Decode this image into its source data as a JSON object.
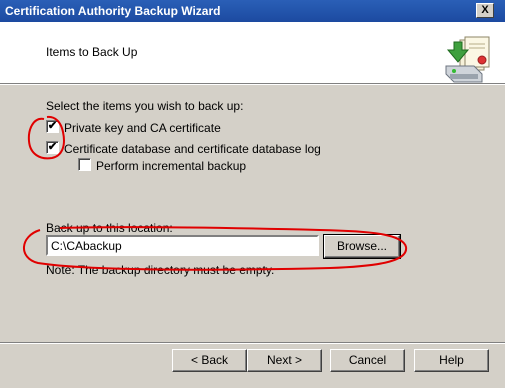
{
  "window": {
    "title": "Certification Authority Backup Wizard",
    "close_label": "X"
  },
  "header": {
    "heading": "Items to Back Up"
  },
  "items": {
    "prompt": "Select the items you wish to back up:",
    "private_key": {
      "label": "Private key and CA certificate",
      "checked": true,
      "mark": "✔"
    },
    "database": {
      "label": "Certificate database and certificate database log",
      "checked": true,
      "mark": "✔"
    },
    "incremental": {
      "label": "Perform incremental backup",
      "checked": false,
      "mark": ""
    }
  },
  "location": {
    "label": "Back up to this location:",
    "value": "C:\\CAbackup",
    "browse_label": "Browse...",
    "note": "Note: The backup directory must be empty."
  },
  "buttons": {
    "back": "< Back",
    "next": "Next >",
    "cancel": "Cancel",
    "help": "Help"
  },
  "colors": {
    "title_bar": "#1c4aa0",
    "dialog_bg": "#d4d0c8",
    "annotation": "#e00000"
  }
}
